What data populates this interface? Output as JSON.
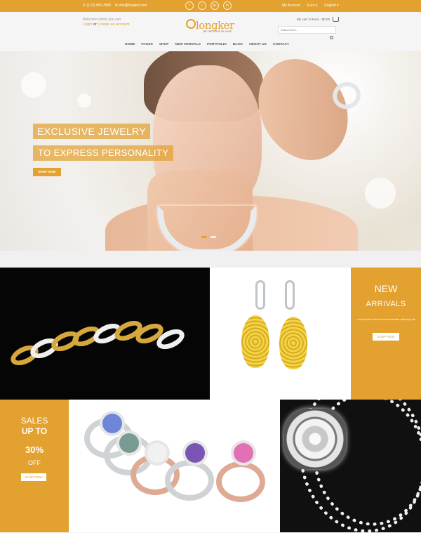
{
  "topbar": {
    "phone": "✆ (123) 456-7890",
    "email": "✉ info@longker.com",
    "social": [
      "f",
      "t",
      "g+",
      "in"
    ],
    "my_account": "My Account",
    "currency": "Euro ▾",
    "language": "English ▾"
  },
  "header": {
    "welcome": "Welcome visitor you can",
    "login": "Login",
    "or": "or",
    "create": "Create an account.",
    "logo_word": "longker",
    "logo_tagline": "BE THE LIGHT OF LOVE",
    "cart_text": "My cart: 0 items - $0.00",
    "search_placeholder": "Search here..."
  },
  "nav": [
    "HOME",
    "PAGES",
    "SHOP",
    "NEW ARRIVALS",
    "PORTFOLIO",
    "BLOG",
    "ABOUT US",
    "CONTACT"
  ],
  "hero": {
    "title": "EXCLUSIVE JEWELRY",
    "subtitle": "TO EXPRESS PERSONALITY",
    "button": "SHOP NOW",
    "slides": 2
  },
  "promo_new": {
    "title": "NEW",
    "subtitle": "ARRIVALS",
    "text": "Lorem ipsum dolor sit amet consectetur adipiscing elit",
    "button": "SHOP NOW"
  },
  "promo_sales": {
    "line1": "SALES",
    "line2": "UP TO",
    "percent": "30%",
    "off": "OFF",
    "button": "SHOP NOW"
  },
  "colors": {
    "accent": "#e3a12f",
    "dark": "#101010",
    "light": "#f4f4f4"
  }
}
